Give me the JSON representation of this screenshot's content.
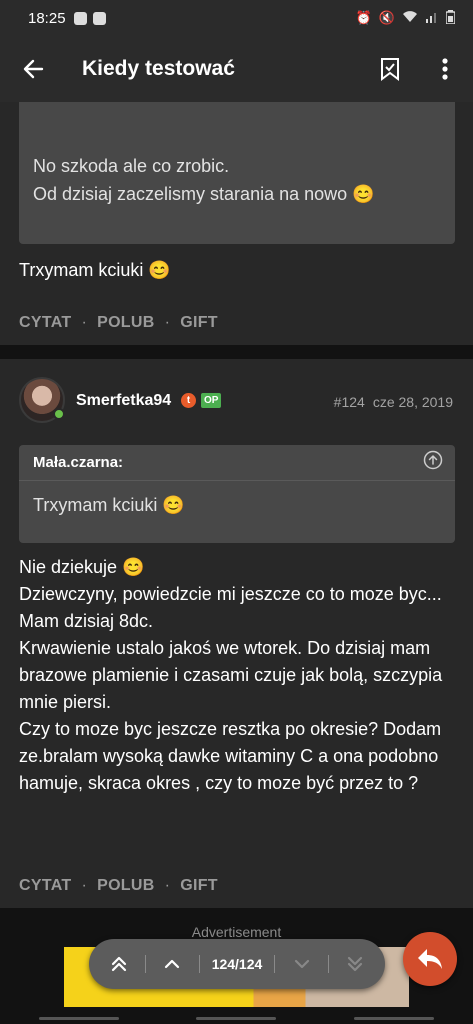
{
  "status": {
    "time": "18:25",
    "icons": [
      "tumblr-icon",
      "download-icon"
    ],
    "right_icons": [
      "alarm-icon",
      "mute-icon",
      "wifi-icon",
      "signal-icon",
      "battery-icon"
    ]
  },
  "appbar": {
    "title": "Kiedy testować",
    "back_icon": "arrow-left-icon",
    "bookmark_icon": "bookmark-icon",
    "more_icon": "more-vertical-icon"
  },
  "post1": {
    "quote_lines": [
      "No szkoda ale co zrobic.",
      "Od dzisiaj zaczelismy starania na nowo 😊"
    ],
    "body": "Trxymam kciuki 😊",
    "actions": {
      "quote": "CYTAT",
      "like": "POLUB",
      "gift": "GIFT",
      "sep": "·"
    }
  },
  "post2": {
    "username": "Smerfetka94",
    "badge_t": "t",
    "badge_op": "OP",
    "number": "#124",
    "date": "cze 28, 2019",
    "quote_author": "Mała.czarna:",
    "quote_body": "Trxymam kciuki 😊",
    "body_lines": [
      "Nie dziekuje 😊",
      "Dziewczyny, powiedzcie mi jeszcze co to moze byc...",
      "Mam dzisiaj 8dc.",
      "Krwawienie ustalo jakoś we wtorek. Do dzisiaj mam brazowe plamienie i czasami czuje jak bolą, szczypia mnie piersi.",
      "Czy to moze byc jeszcze resztka po okresie? Dodam ze.bralam wysoką dawke witaminy C a ona podobno hamuje, skraca okres , czy to moze być przez to ?"
    ],
    "actions": {
      "quote": "CYTAT",
      "like": "POLUB",
      "gift": "GIFT",
      "sep": "·"
    }
  },
  "ad": {
    "label": "Advertisement"
  },
  "pager": {
    "current": "124/124"
  },
  "colors": {
    "accent": "#d24d2c",
    "online": "#6ac04a",
    "op_badge": "#4caf50"
  }
}
